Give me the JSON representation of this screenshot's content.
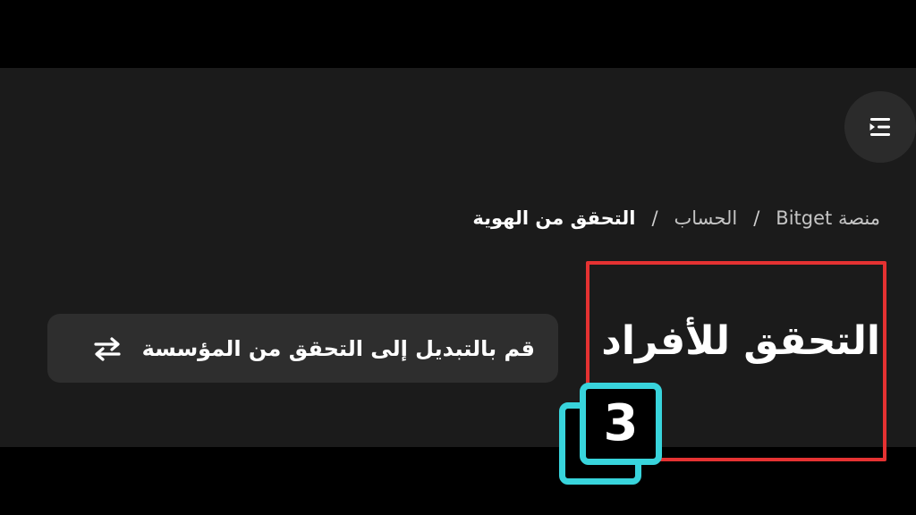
{
  "breadcrumb": {
    "items": [
      "منصة Bitget",
      "الحساب",
      "التحقق من الهوية"
    ],
    "separator": "/"
  },
  "page": {
    "title": "التحقق للأفراد"
  },
  "switch": {
    "label": "قم بالتبديل إلى التحقق من المؤسسة",
    "icon": "swap-arrows-icon"
  },
  "menu": {
    "icon": "menu-collapse-icon"
  },
  "annotation": {
    "step_number": "3",
    "highlight_color": "#e53232",
    "badge_color": "#38d4dc"
  },
  "colors": {
    "background": "#000000",
    "panel": "#1b1b1b",
    "button": "#2e2e2e"
  }
}
